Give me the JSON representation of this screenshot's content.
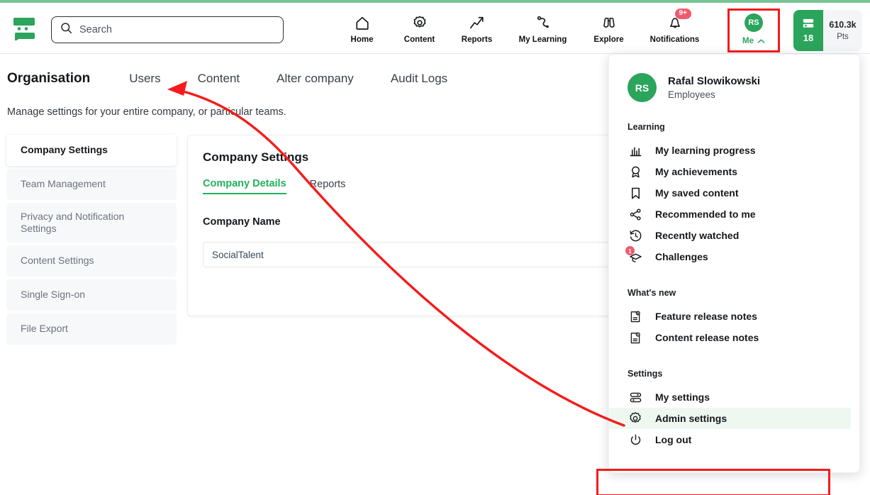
{
  "header": {
    "logo_name": "socialtalent-logo",
    "search": {
      "placeholder": "Search"
    },
    "nav": [
      {
        "label": "Home",
        "icon": "home-icon"
      },
      {
        "label": "Content",
        "icon": "gear-content-icon"
      },
      {
        "label": "Reports",
        "icon": "trending-arrow-icon"
      },
      {
        "label": "My Learning",
        "icon": "learning-path-icon"
      },
      {
        "label": "Explore",
        "icon": "binoculars-icon"
      },
      {
        "label": "Notifications",
        "icon": "bell-icon",
        "badge": "9+"
      }
    ],
    "me": {
      "initials": "RS",
      "label": "Me",
      "chevron": "chevron-up-icon"
    },
    "points": {
      "level": "18",
      "value": "610.3k",
      "unit": "Pts"
    }
  },
  "page": {
    "title": "Organisation",
    "tabs": [
      "Users",
      "Content",
      "Alter company",
      "Audit Logs"
    ],
    "subtitle": "Manage settings for your entire company, or particular teams."
  },
  "sidebar": {
    "items": [
      {
        "label": "Company Settings"
      },
      {
        "label": "Team Management"
      },
      {
        "label": "Privacy and Notification Settings"
      },
      {
        "label": "Content Settings"
      },
      {
        "label": "Single Sign-on"
      },
      {
        "label": "File Export"
      }
    ],
    "active_index": 0
  },
  "main": {
    "title": "Company Settings",
    "tabs": [
      "Company Details",
      "Reports"
    ],
    "active_tab": "Company Details",
    "field_label": "Company Name",
    "field_value": "SocialTalent"
  },
  "dropdown": {
    "user": {
      "initials": "RS",
      "name": "Rafal Slowikowski",
      "role": "Employees"
    },
    "sections": [
      {
        "title": "Learning",
        "items": [
          {
            "label": "My learning progress",
            "icon": "bar-chart-icon"
          },
          {
            "label": "My achievements",
            "icon": "award-medal-icon"
          },
          {
            "label": "My saved content",
            "icon": "bookmark-icon"
          },
          {
            "label": "Recommended to me",
            "icon": "share-icon"
          },
          {
            "label": "Recently watched",
            "icon": "history-clock-icon"
          },
          {
            "label": "Challenges",
            "icon": "graduation-cap-icon",
            "badge": "1"
          }
        ]
      },
      {
        "title": "What's new",
        "items": [
          {
            "label": "Feature release notes",
            "icon": "document-star-icon"
          },
          {
            "label": "Content release notes",
            "icon": "document-play-icon"
          }
        ]
      },
      {
        "title": "Settings",
        "items": [
          {
            "label": "My settings",
            "icon": "sliders-icon"
          },
          {
            "label": "Admin settings",
            "icon": "gear-icon",
            "highlighted": true
          },
          {
            "label": "Log out",
            "icon": "power-icon"
          }
        ]
      }
    ]
  },
  "colors": {
    "brand_green": "#2ba45c",
    "tab_green": "#22b15c",
    "annotation_red": "#f51b1b",
    "badge_red": "#ef5b6e",
    "highlight_bg": "#eef8f1"
  }
}
